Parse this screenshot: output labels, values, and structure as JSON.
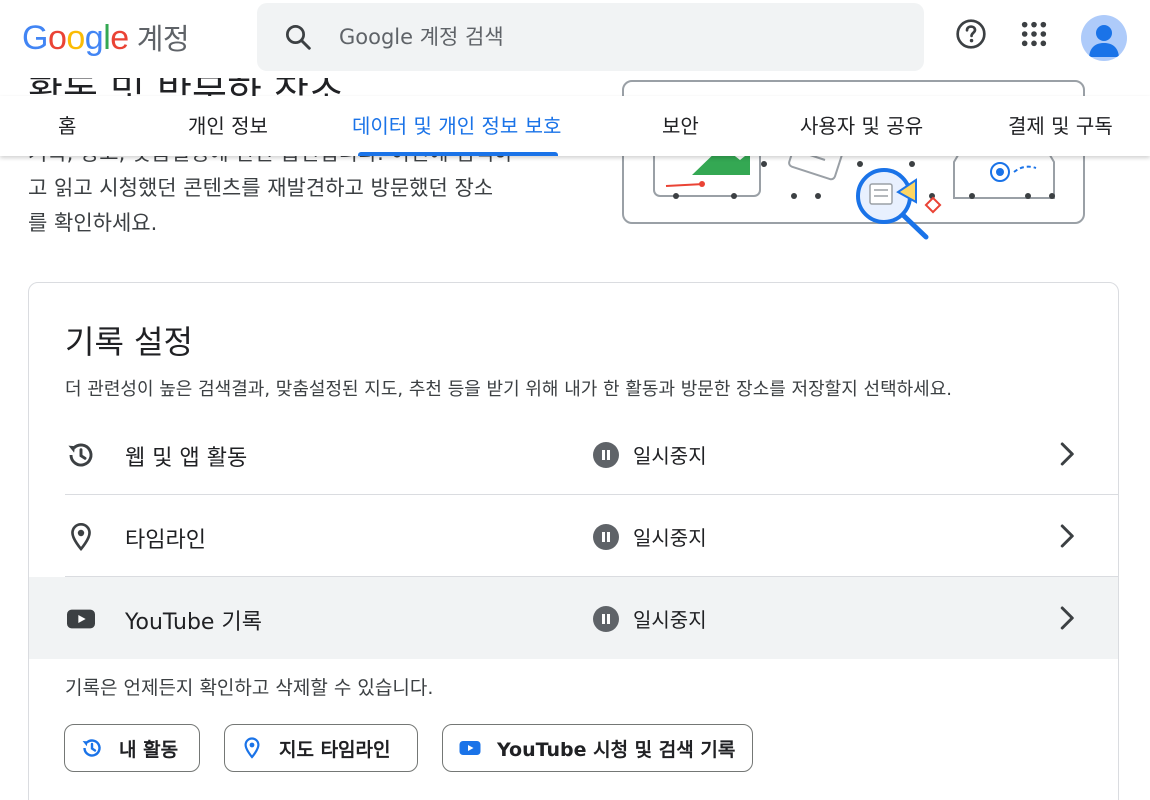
{
  "header": {
    "logo_letters": [
      "G",
      "o",
      "o",
      "g",
      "l",
      "e"
    ],
    "logo_suffix": "계정",
    "search_placeholder": "Google 계정 검색",
    "icons": [
      "help-icon",
      "apps-grid-icon",
      "account-avatar"
    ]
  },
  "hero": {
    "title": "활동 및 방문한 장소",
    "description_lines": [
      "기록, 광고, 맞춤설정에 관한 옵션입니다. 이전에 검색하",
      "고 읽고 시청했던 콘텐츠를 재발견하고 방문했던 장소",
      "를 확인하세요."
    ]
  },
  "tabs": [
    {
      "label": "홈",
      "active": false
    },
    {
      "label": "개인 정보",
      "active": false
    },
    {
      "label": "데이터 및 개인 정보 보호",
      "active": true
    },
    {
      "label": "보안",
      "active": false
    },
    {
      "label": "사용자 및 공유",
      "active": false
    },
    {
      "label": "결제 및 구독",
      "active": false
    }
  ],
  "card": {
    "title": "기록 설정",
    "description": "더 관련성이 높은 검색결과, 맞춤설정된 지도, 추천 등을 받기 위해 내가 한 활동과 방문한 장소를 저장할지 선택하세요.",
    "rows": [
      {
        "label": "웹 및 앱 활동",
        "icon": "history-icon",
        "status": "일시중지"
      },
      {
        "label": "타임라인",
        "icon": "location-pin-icon",
        "status": "일시중지"
      },
      {
        "label": "YouTube 기록",
        "icon": "youtube-icon",
        "status": "일시중지"
      }
    ],
    "footer_text": "기록은 언제든지 확인하고 삭제할 수 있습니다.",
    "chips": [
      {
        "label": "내 활동",
        "icon": "history-icon"
      },
      {
        "label": "지도 타임라인",
        "icon": "location-pin-icon"
      },
      {
        "label": "YouTube 시청 및 검색 기록",
        "icon": "youtube-icon"
      }
    ]
  },
  "colors": {
    "accent": "#1a73e8",
    "text": "#202124",
    "secondary_text": "#5f6368",
    "divider": "#dadce0",
    "highlight_row": "#f1f3f4"
  }
}
